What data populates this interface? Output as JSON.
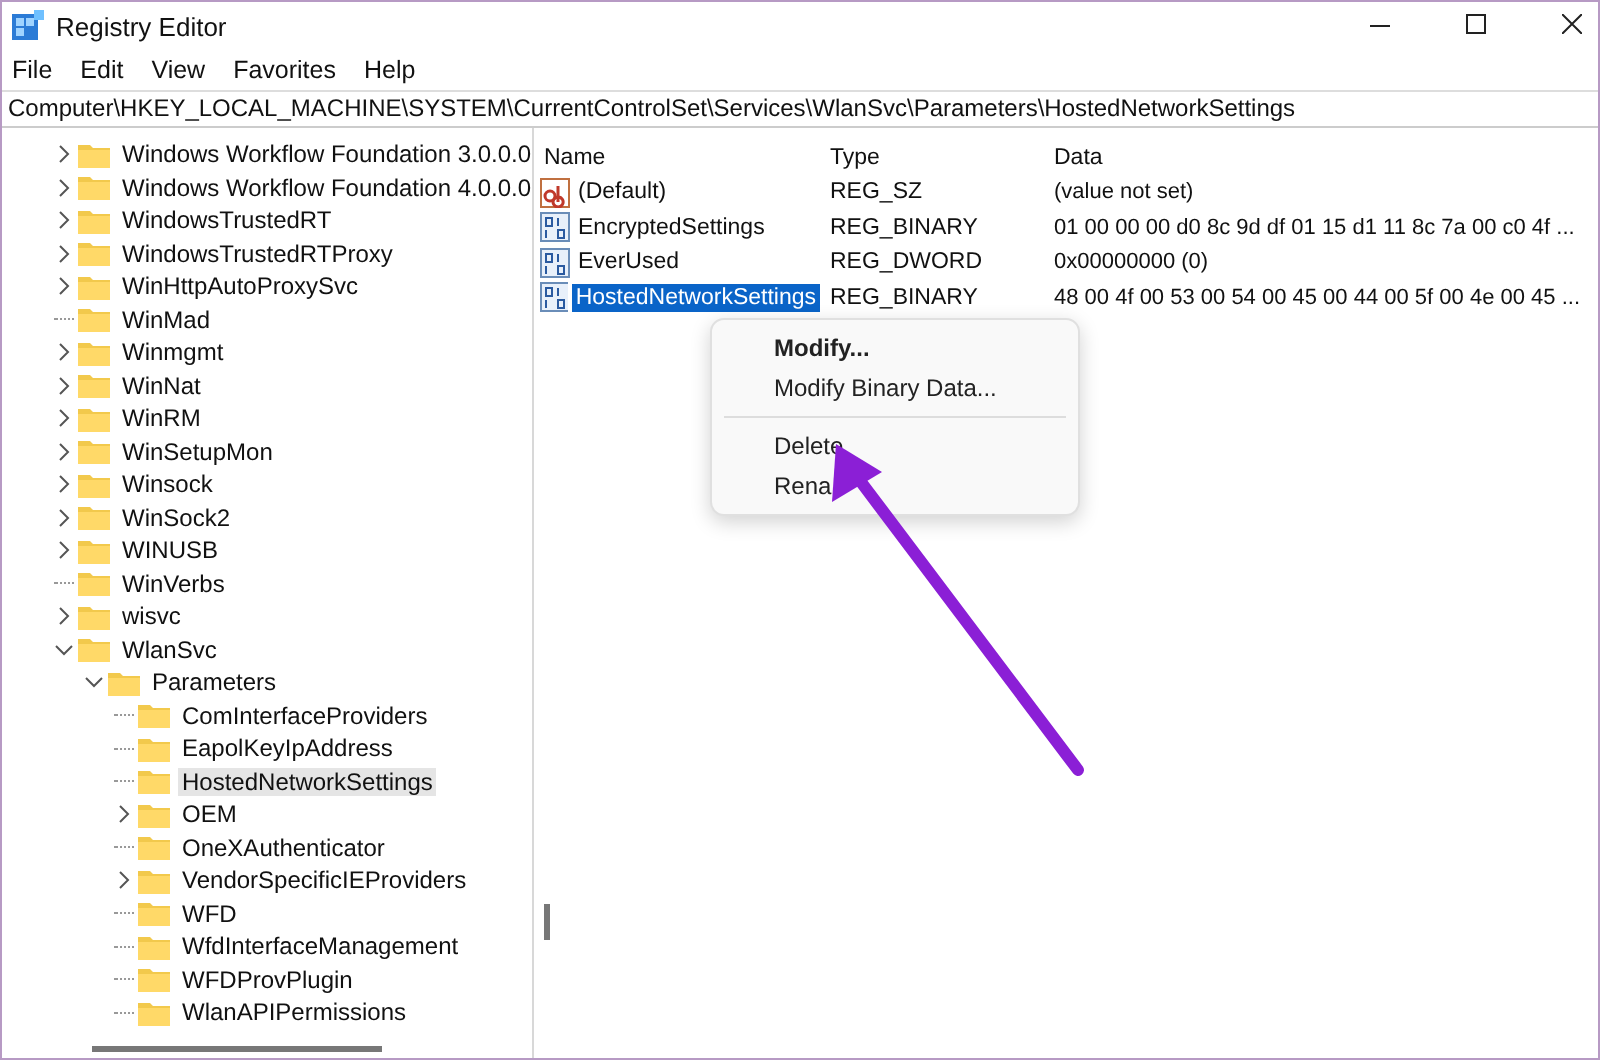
{
  "window": {
    "title": "Registry Editor"
  },
  "menu_bar": [
    "File",
    "Edit",
    "View",
    "Favorites",
    "Help"
  ],
  "address_bar": "Computer\\HKEY_LOCAL_MACHINE\\SYSTEM\\CurrentControlSet\\Services\\WlanSvc\\Parameters\\HostedNetworkSettings",
  "tree": [
    {
      "label": "Windows Workflow Foundation 3.0.0.0",
      "expandable": true,
      "selected": false
    },
    {
      "label": "Windows Workflow Foundation 4.0.0.0",
      "expandable": true,
      "selected": false
    },
    {
      "label": "WindowsTrustedRT",
      "expandable": true,
      "selected": false
    },
    {
      "label": "WindowsTrustedRTProxy",
      "expandable": true,
      "selected": false
    },
    {
      "label": "WinHttpAutoProxySvc",
      "expandable": true,
      "selected": false
    },
    {
      "label": "WinMad",
      "expandable": false,
      "selected": false
    },
    {
      "label": "Winmgmt",
      "expandable": true,
      "selected": false
    },
    {
      "label": "WinNat",
      "expandable": true,
      "selected": false
    },
    {
      "label": "WinRM",
      "expandable": true,
      "selected": false
    },
    {
      "label": "WinSetupMon",
      "expandable": true,
      "selected": false
    },
    {
      "label": "Winsock",
      "expandable": true,
      "selected": false
    },
    {
      "label": "WinSock2",
      "expandable": true,
      "selected": false
    },
    {
      "label": "WINUSB",
      "expandable": true,
      "selected": false
    },
    {
      "label": "WinVerbs",
      "expandable": false,
      "selected": false
    },
    {
      "label": "wisvc",
      "expandable": true,
      "selected": false
    },
    {
      "label": "WlanSvc",
      "expandable": true,
      "expanded": true,
      "selected": false,
      "children": [
        {
          "label": "Parameters",
          "expandable": true,
          "expanded": true,
          "selected": false,
          "children": [
            {
              "label": "ComInterfaceProviders",
              "expandable": false,
              "selected": false
            },
            {
              "label": "EapolKeyIpAddress",
              "expandable": false,
              "selected": false
            },
            {
              "label": "HostedNetworkSettings",
              "expandable": false,
              "selected": true
            },
            {
              "label": "OEM",
              "expandable": true,
              "selected": false
            },
            {
              "label": "OneXAuthenticator",
              "expandable": false,
              "selected": false
            },
            {
              "label": "VendorSpecificIEProviders",
              "expandable": true,
              "selected": false
            },
            {
              "label": "WFD",
              "expandable": false,
              "selected": false
            },
            {
              "label": "WfdInterfaceManagement",
              "expandable": false,
              "selected": false
            },
            {
              "label": "WFDProvPlugin",
              "expandable": false,
              "selected": false
            },
            {
              "label": "WlanAPIPermissions",
              "expandable": false,
              "selected": false
            }
          ]
        }
      ]
    }
  ],
  "values": {
    "columns": [
      "Name",
      "Type",
      "Data"
    ],
    "rows": [
      {
        "kind": "string",
        "name": "(Default)",
        "type": "REG_SZ",
        "data": "(value not set)",
        "selected": false
      },
      {
        "kind": "binary",
        "name": "EncryptedSettings",
        "type": "REG_BINARY",
        "data": "01 00 00 00 d0 8c 9d df 01 15 d1 11 8c 7a 00 c0 4f ...",
        "selected": false
      },
      {
        "kind": "binary",
        "name": "EverUsed",
        "type": "REG_DWORD",
        "data": "0x00000000 (0)",
        "selected": false
      },
      {
        "kind": "binary",
        "name": "HostedNetworkSettings",
        "type": "REG_BINARY",
        "data": "48 00 4f 00 53 00 54 00 45 00 44 00 5f 00 4e 00 45 ...",
        "selected": true
      }
    ]
  },
  "context_menu": [
    {
      "kind": "default",
      "label": "Modify..."
    },
    {
      "kind": "item",
      "label": "Modify Binary Data..."
    },
    {
      "kind": "separator"
    },
    {
      "kind": "item",
      "label": "Delete"
    },
    {
      "kind": "item",
      "label": "Rena"
    }
  ]
}
